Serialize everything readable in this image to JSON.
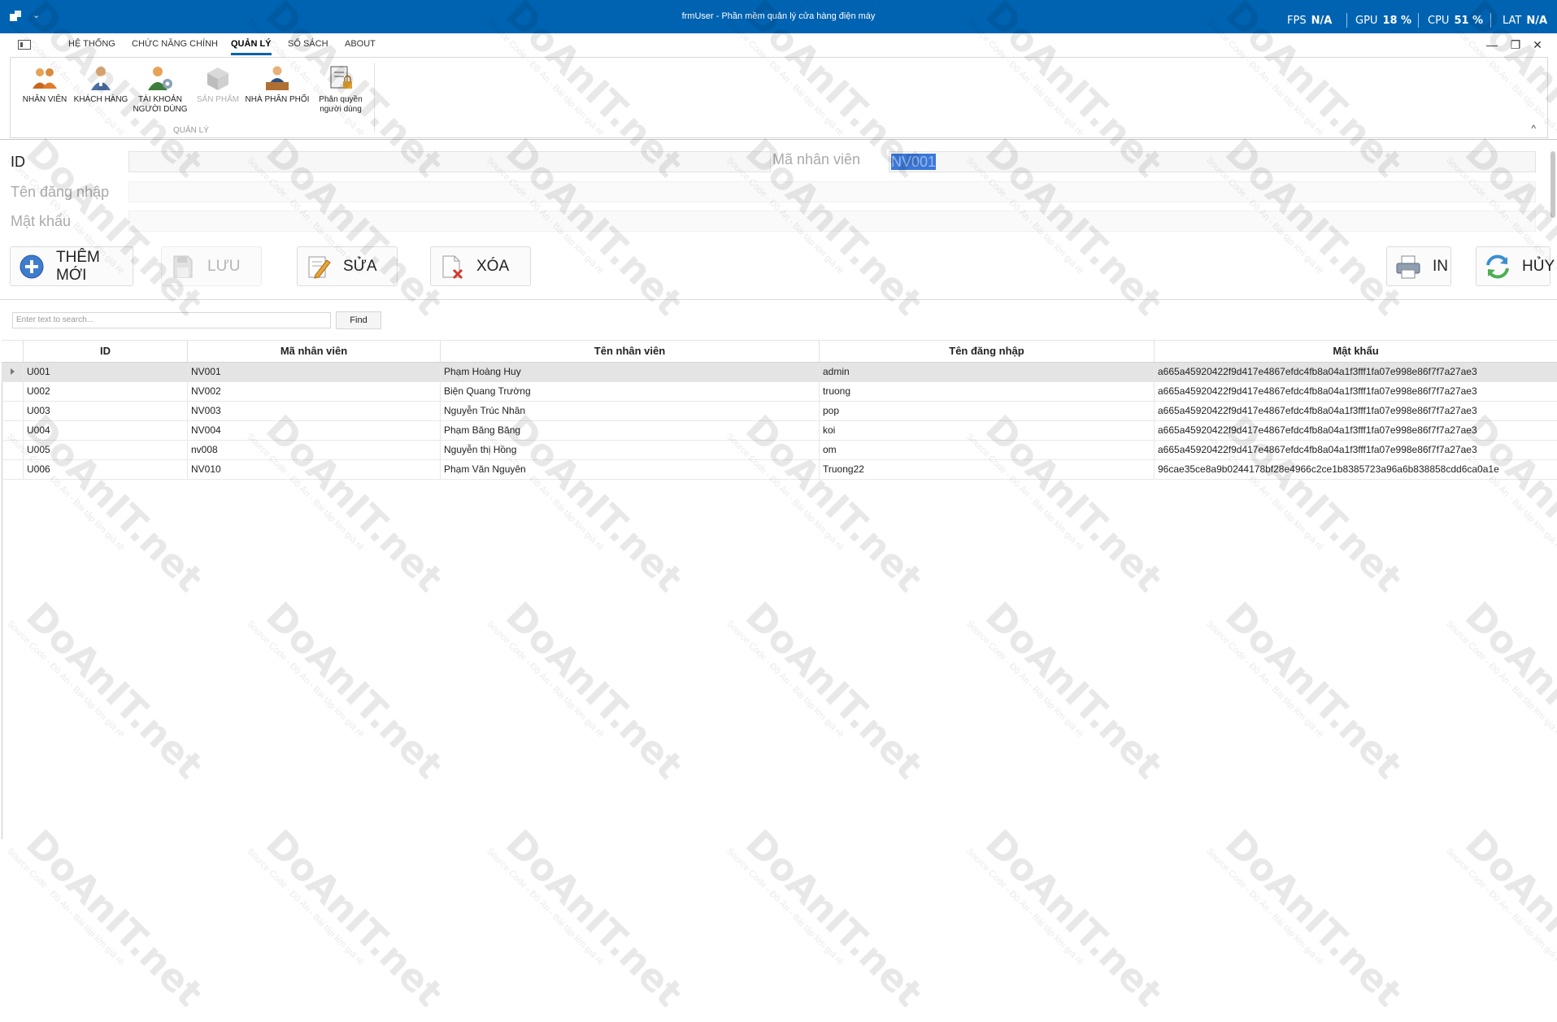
{
  "window": {
    "title": "frmUser - Phần mềm quản lý cửa hàng điện máy",
    "quick_access": "≡",
    "perf": [
      {
        "label": "FPS",
        "value": "N/A"
      },
      {
        "label": "GPU",
        "value": "18 %"
      },
      {
        "label": "CPU",
        "value": "51 %"
      },
      {
        "label": "LAT",
        "value": "N/A"
      }
    ],
    "controls": {
      "minimize": "—",
      "restore": "❐",
      "close": "✕"
    }
  },
  "ribbon": {
    "tabs": [
      {
        "label": "HỆ THỐNG",
        "active": false
      },
      {
        "label": "CHỨC NĂNG CHÍNH",
        "active": false
      },
      {
        "label": "QUẢN LÝ",
        "active": true
      },
      {
        "label": "SỔ SÁCH",
        "active": false
      },
      {
        "label": "ABOUT",
        "active": false
      }
    ],
    "buttons": [
      {
        "line1": "NHÂN VIÊN",
        "line2": "",
        "icon": "staff-icon",
        "disabled": false
      },
      {
        "line1": "KHÁCH HÀNG",
        "line2": "",
        "icon": "customer-icon",
        "disabled": false
      },
      {
        "line1": "TÀI KHOẢN",
        "line2": "NGƯỜI DÙNG",
        "icon": "user-account-icon",
        "disabled": false
      },
      {
        "line1": "SẢN PHẨM",
        "line2": "",
        "icon": "product-box-icon",
        "disabled": true
      },
      {
        "line1": "NHÀ PHÂN PHỐI",
        "line2": "",
        "icon": "distributor-icon",
        "disabled": false
      },
      {
        "line1": "Phân quyền",
        "line2": "người dùng",
        "icon": "permission-icon",
        "disabled": false
      }
    ],
    "group_label": "QUẢN LÝ",
    "collapse": "^"
  },
  "form": {
    "id_label": "ID",
    "id_value": "",
    "manv_label": "Mã nhân viên",
    "manv_value": "NV001",
    "username_label": "Tên đăng nhập",
    "username_value": "",
    "password_label": "Mật khẩu",
    "password_value": ""
  },
  "actions": {
    "add": "THÊM MỚI",
    "save": "LƯU",
    "edit": "SỬA",
    "delete": "XÓA",
    "print": "IN",
    "cancel": "HỦY"
  },
  "search": {
    "placeholder": "Enter text to search...",
    "find": "Find"
  },
  "grid": {
    "columns": [
      "ID",
      "Mã nhân viên",
      "Tên nhân viên",
      "Tên đăng nhập",
      "Mật khẩu"
    ],
    "rows": [
      [
        "U001",
        "NV001",
        "Phạm Hoàng Huy",
        "admin",
        "a665a45920422f9d417e4867efdc4fb8a04a1f3fff1fa07e998e86f7f7a27ae3"
      ],
      [
        "U002",
        "NV002",
        "Biện Quang Trường",
        "truong",
        "a665a45920422f9d417e4867efdc4fb8a04a1f3fff1fa07e998e86f7f7a27ae3"
      ],
      [
        "U003",
        "NV003",
        "Nguyễn Trúc Nhân",
        "pop",
        "a665a45920422f9d417e4867efdc4fb8a04a1f3fff1fa07e998e86f7f7a27ae3"
      ],
      [
        "U004",
        "NV004",
        "Phạm Băng Băng",
        "koi",
        "a665a45920422f9d417e4867efdc4fb8a04a1f3fff1fa07e998e86f7f7a27ae3"
      ],
      [
        "U005",
        "nv008",
        "Nguyễn thị Hồng",
        "om",
        "a665a45920422f9d417e4867efdc4fb8a04a1f3fff1fa07e998e86f7f7a27ae3"
      ],
      [
        "U006",
        "NV010",
        "Phạm Văn Nguyên",
        "Truong22",
        "96cae35ce8a9b0244178bf28e4966c2ce1b8385723a96a6b838858cdd6ca0a1e"
      ]
    ],
    "selected_row": 0
  },
  "watermark": {
    "brand": "DoAnIT.net",
    "tagline": "Source Code - Đồ Án - Bài tập lớn giá rẻ"
  },
  "colors": {
    "titlebar": "#0063b1",
    "accent": "#0063b1"
  }
}
